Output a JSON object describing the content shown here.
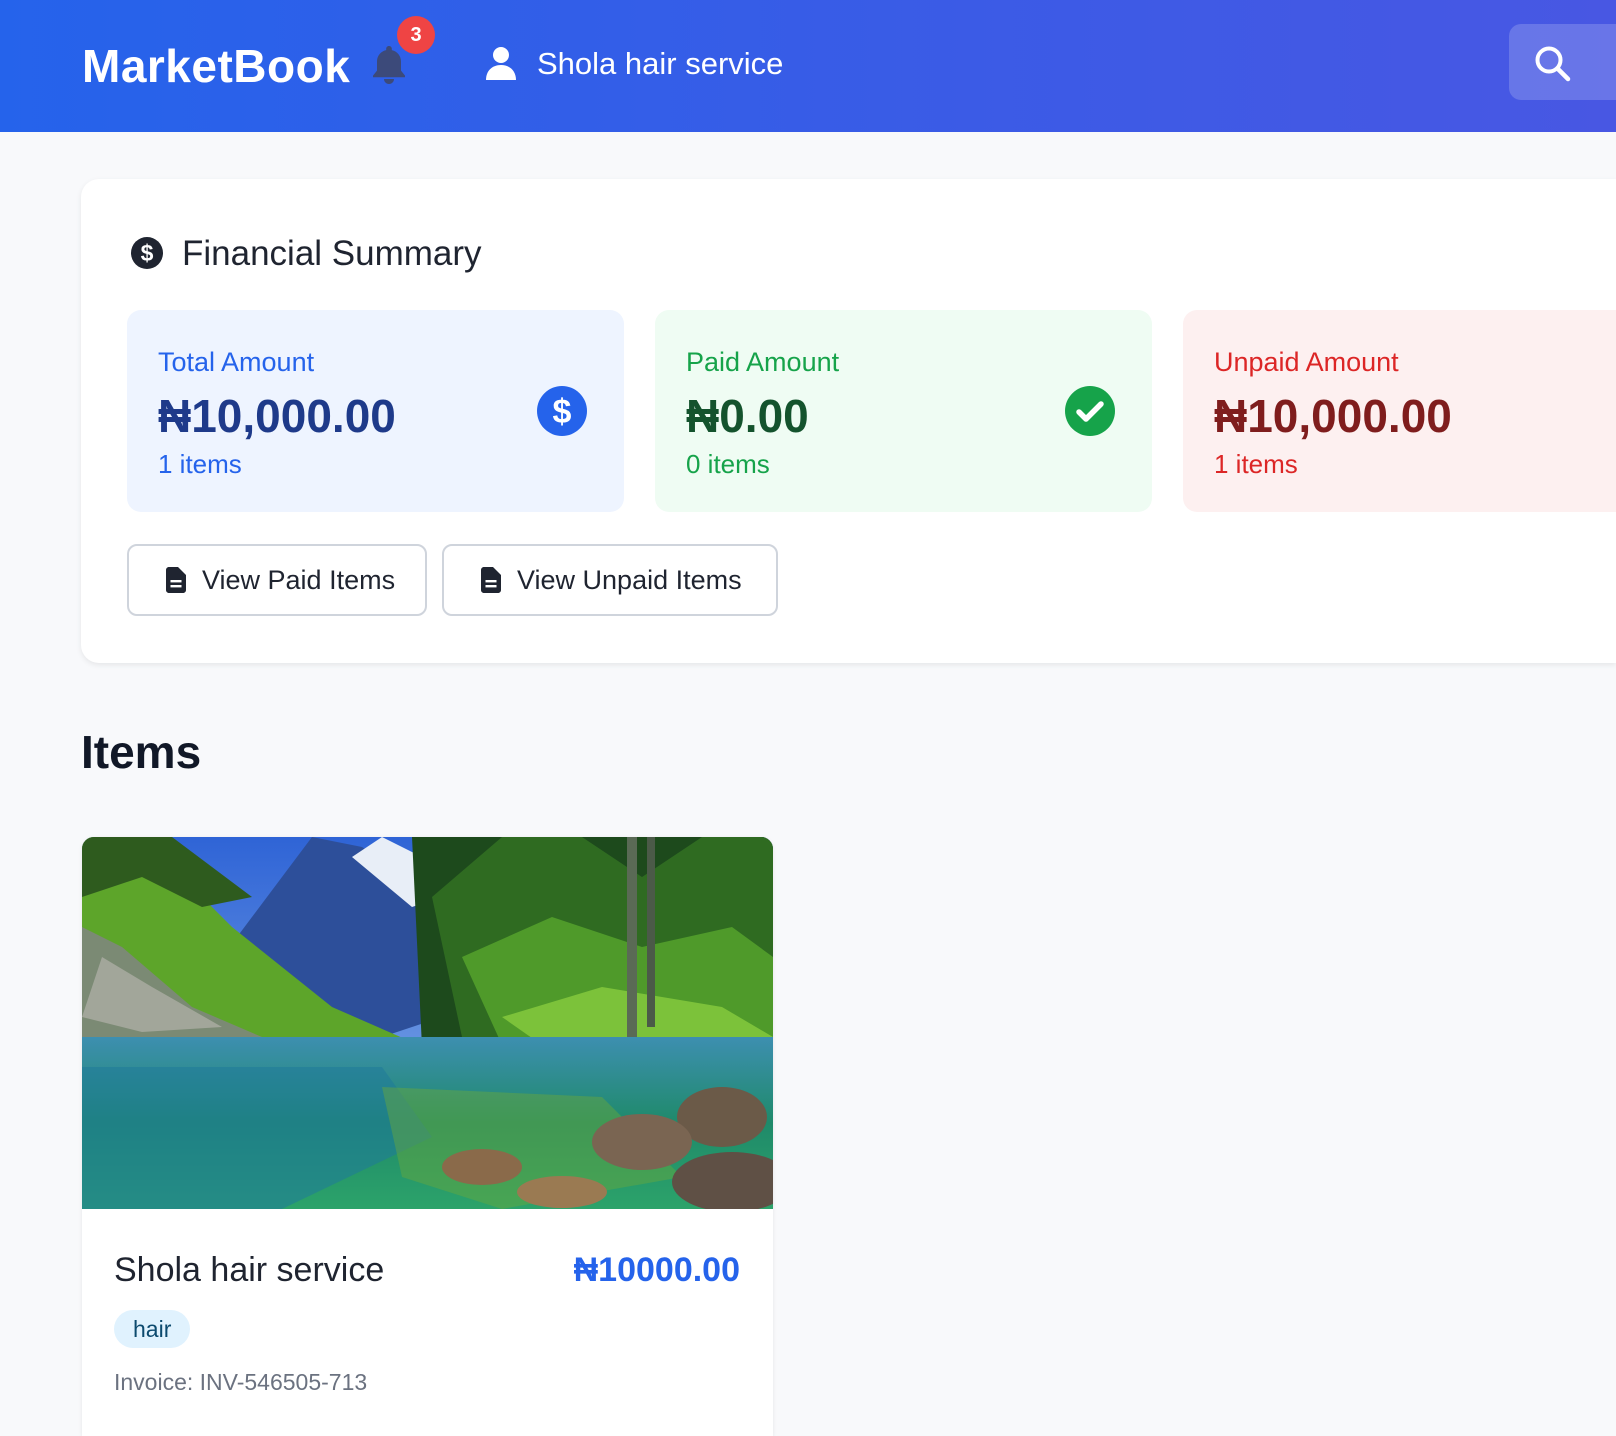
{
  "header": {
    "brand": "MarketBook",
    "notification_count": "3",
    "user_name": "Shola hair service"
  },
  "summary": {
    "title": "Financial Summary",
    "total": {
      "label": "Total Amount",
      "value": "₦10,000.00",
      "count": "1 items",
      "color": "#2563eb",
      "icon": "dollar-circle-icon"
    },
    "paid": {
      "label": "Paid Amount",
      "value": "₦0.00",
      "count": "0 items",
      "color": "#16a34a",
      "icon": "check-circle-icon"
    },
    "unpaid": {
      "label": "Unpaid Amount",
      "value": "₦10,000.00",
      "count": "1 items",
      "color": "#dc2626"
    },
    "view_paid_label": "View Paid Items",
    "view_unpaid_label": "View Unpaid Items"
  },
  "items_heading": "Items",
  "items": [
    {
      "title": "Shola hair service",
      "price": "₦10000.00",
      "tag": "hair",
      "invoice": "Invoice: INV-546505-713"
    }
  ],
  "colors": {
    "header_start": "#2563eb",
    "header_end": "#4857e3",
    "badge": "#ef4444"
  }
}
